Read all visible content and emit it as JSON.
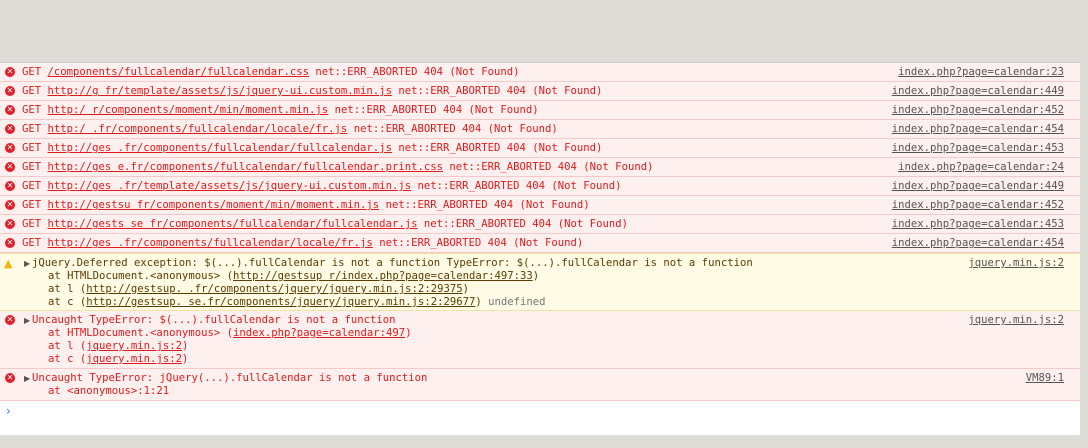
{
  "network_errors": [
    {
      "method": "GET",
      "url": "/components/fullcalendar/fullcalendar.css",
      "status": "net::ERR_ABORTED 404 (Not Found)",
      "source": "index.php?page=calendar:23"
    },
    {
      "method": "GET",
      "url": "http://g fr/template/assets/js/jquery-ui.custom.min.js",
      "status": "net::ERR_ABORTED 404 (Not Found)",
      "source": "index.php?page=calendar:449"
    },
    {
      "method": "GET",
      "url": "http:/ r/components/moment/min/moment.min.js",
      "status": "net::ERR_ABORTED 404 (Not Found)",
      "source": "index.php?page=calendar:452"
    },
    {
      "method": "GET",
      "url": "http:/ .fr/components/fullcalendar/locale/fr.js",
      "status": "net::ERR_ABORTED 404 (Not Found)",
      "source": "index.php?page=calendar:454"
    },
    {
      "method": "GET",
      "url": "http://ges .fr/components/fullcalendar/fullcalendar.js",
      "status": "net::ERR_ABORTED 404 (Not Found)",
      "source": "index.php?page=calendar:453"
    },
    {
      "method": "GET",
      "url": "http://ges e.fr/components/fullcalendar/fullcalendar.print.css",
      "status": "net::ERR_ABORTED 404 (Not Found)",
      "source": "index.php?page=calendar:24"
    },
    {
      "method": "GET",
      "url": "http://ges .fr/template/assets/js/jquery-ui.custom.min.js",
      "status": "net::ERR_ABORTED 404 (Not Found)",
      "source": "index.php?page=calendar:449"
    },
    {
      "method": "GET",
      "url": "http://gestsu fr/components/moment/min/moment.min.js",
      "status": "net::ERR_ABORTED 404 (Not Found)",
      "source": "index.php?page=calendar:452"
    },
    {
      "method": "GET",
      "url": "http://gests se fr/components/fullcalendar/fullcalendar.js",
      "status": "net::ERR_ABORTED 404 (Not Found)",
      "source": "index.php?page=calendar:453"
    },
    {
      "method": "GET",
      "url": "http://ges .fr/components/fullcalendar/locale/fr.js",
      "status": "net::ERR_ABORTED 404 (Not Found)",
      "source": "index.php?page=calendar:454"
    }
  ],
  "warning": {
    "message": "jQuery.Deferred exception: $(...).fullCalendar is not a function TypeError: $(...).fullCalendar is not a function",
    "source": "jquery.min.js:2",
    "stack": [
      {
        "prefix": "at HTMLDocument.<anonymous> (",
        "link": "http://gestsup r/index.php?page=calendar:497:33",
        "suffix": ")"
      },
      {
        "prefix": "at l (",
        "link": "http://gestsup. .fr/components/jquery/jquery.min.js:2:29375",
        "suffix": ")"
      },
      {
        "prefix": "at c (",
        "link": "http://gestsup. se.fr/components/jquery/jquery.min.js:2:29677",
        "suffix": ")",
        "extra": "undefined"
      }
    ]
  },
  "error1": {
    "message": "Uncaught TypeError: $(...).fullCalendar is not a function",
    "source": "jquery.min.js:2",
    "stack": [
      {
        "prefix": "at HTMLDocument.<anonymous> (",
        "link": "index.php?page=calendar:497",
        "suffix": ")"
      },
      {
        "prefix": "at l (",
        "link": "jquery.min.js:2",
        "suffix": ")"
      },
      {
        "prefix": "at c (",
        "link": "jquery.min.js:2",
        "suffix": ")"
      }
    ]
  },
  "error2": {
    "message": "Uncaught TypeError: jQuery(...).fullCalendar is not a function",
    "source": "VM89:1",
    "stack_line": "at <anonymous>:1:21"
  },
  "icons": {
    "error": "error-circle-icon",
    "warning": "warning-triangle-icon",
    "expand": "expand-triangle-icon",
    "prompt": "console-prompt-icon"
  },
  "colors": {
    "error_text": "#e01b1b",
    "error_bg": "#fff0f0",
    "warning_bg": "#fffbe5",
    "link_gray": "#545454"
  }
}
